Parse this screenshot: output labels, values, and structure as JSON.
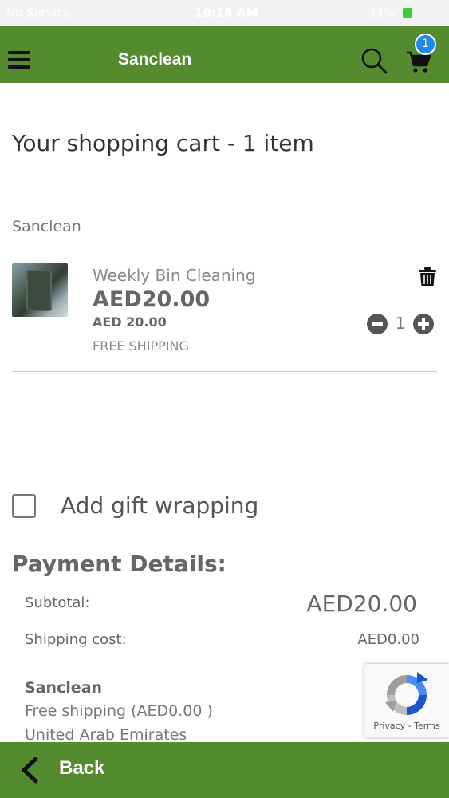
{
  "status_bar": {
    "carrier": "No Service",
    "time": "10:16 AM",
    "battery": "33%"
  },
  "header": {
    "title": "Sanclean",
    "cart_count": "1",
    "menu_icon": "hamburger-menu-icon",
    "search_icon": "search-icon",
    "cart_icon": "shopping-cart-icon",
    "bg_color": "#558b2f",
    "badge_color": "#1e88e5"
  },
  "cart": {
    "title": "Your shopping cart - 1 item",
    "seller": "Sanclean",
    "items": [
      {
        "name": "Weekly Bin Cleaning",
        "price": "AED20.00",
        "unit_price": "AED 20.00",
        "shipping": "FREE SHIPPING",
        "quantity": "1"
      }
    ]
  },
  "gift": {
    "label": "Add gift wrapping",
    "checked": false
  },
  "payment": {
    "heading": "Payment Details:",
    "subtotal_label": "Subtotal:",
    "subtotal_value": "AED20.00",
    "shipping_label": "Shipping cost:",
    "shipping_value": "AED0.00",
    "shipping_seller": "Sanclean",
    "shipping_method": "Free shipping (AED0.00 )",
    "shipping_country": "United Arab Emirates"
  },
  "recaptcha": {
    "privacy": "Privacy",
    "separator": " - ",
    "terms": "Terms"
  },
  "footer": {
    "back_label": "Back",
    "back_icon": "chevron-left-icon"
  }
}
